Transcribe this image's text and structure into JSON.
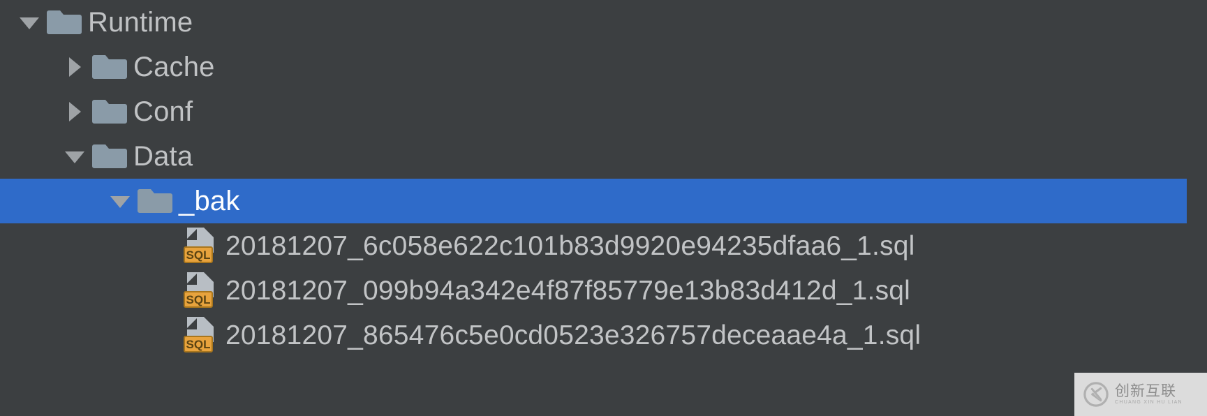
{
  "theme": {
    "background": "#3c3f41",
    "text_color": "#c0c2c4",
    "selection_color": "#2f6bc9",
    "selected_text_color": "#ffffff",
    "folder_icon_color": "#8a9ba8",
    "arrow_color": "#9fa3a6",
    "sql_icon_accent": "#e8a33d"
  },
  "tree": {
    "name": "project-file-tree",
    "rows": [
      {
        "label": "Runtime",
        "kind": "folder",
        "icon": "folder-icon",
        "twisty": "expanded",
        "twisty_icon": "chevron-down-icon",
        "depth": 0,
        "selected": false
      },
      {
        "label": "Cache",
        "kind": "folder",
        "icon": "folder-icon",
        "twisty": "collapsed",
        "twisty_icon": "chevron-right-icon",
        "depth": 1,
        "selected": false
      },
      {
        "label": "Conf",
        "kind": "folder",
        "icon": "folder-icon",
        "twisty": "collapsed",
        "twisty_icon": "chevron-right-icon",
        "depth": 1,
        "selected": false
      },
      {
        "label": "Data",
        "kind": "folder",
        "icon": "folder-icon",
        "twisty": "expanded",
        "twisty_icon": "chevron-down-icon",
        "depth": 1,
        "selected": false
      },
      {
        "label": "_bak",
        "kind": "folder",
        "icon": "folder-icon",
        "twisty": "expanded",
        "twisty_icon": "chevron-down-icon",
        "depth": 2,
        "selected": true
      },
      {
        "label": "20181207_6c058e622c101b83d9920e94235dfaa6_1.sql",
        "kind": "file",
        "icon": "sql-file-icon",
        "twisty": "none",
        "twisty_icon": "",
        "depth": 3,
        "selected": false
      },
      {
        "label": "20181207_099b94a342e4f87f85779e13b83d412d_1.sql",
        "kind": "file",
        "icon": "sql-file-icon",
        "twisty": "none",
        "twisty_icon": "",
        "depth": 3,
        "selected": false
      },
      {
        "label": "20181207_865476c5e0cd0523e326757deceaae4a_1.sql",
        "kind": "file",
        "icon": "sql-file-icon",
        "twisty": "none",
        "twisty_icon": "",
        "depth": 3,
        "selected": false
      }
    ]
  },
  "sql_icon_label": "SQL",
  "watermark": {
    "name": "site-watermark",
    "logo_icon": "circle-x-logo-icon",
    "chinese_text": "创新互联",
    "pinyin_text": "CHUANG XIN HU LIAN"
  }
}
